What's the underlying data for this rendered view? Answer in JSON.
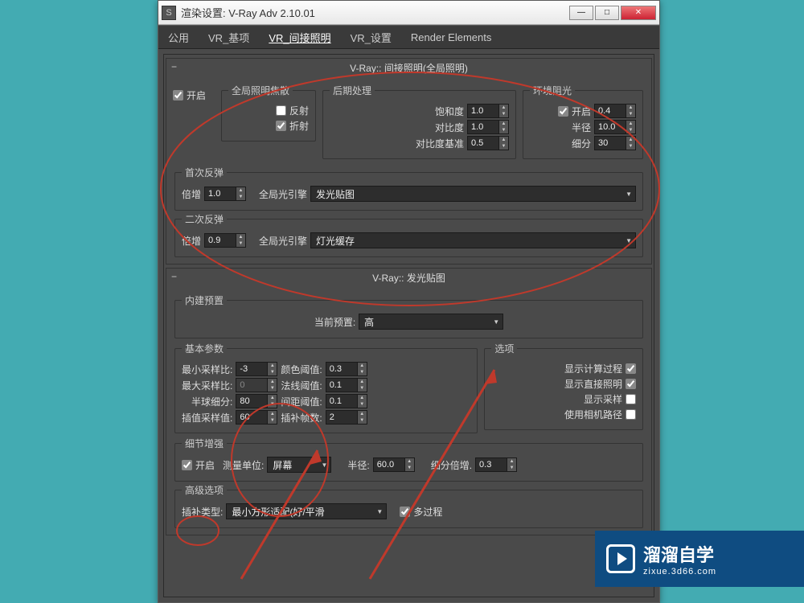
{
  "window": {
    "title": "渲染设置: V-Ray Adv 2.10.01",
    "min": "—",
    "max": "□",
    "close": "✕"
  },
  "tabs": {
    "common": "公用",
    "vrbase": "VR_基项",
    "vrindirect": "VR_间接照明",
    "vrsettings": "VR_设置",
    "renderelem": "Render Elements"
  },
  "rollout1": {
    "title": "V-Ray:: 间接照明(全局照明)",
    "enable": "开启",
    "caustics": {
      "legend": "全局照明焦散",
      "reflect": "反射",
      "refract": "折射"
    },
    "post": {
      "legend": "后期处理",
      "sat_label": "饱和度",
      "sat_val": "1.0",
      "contrast_label": "对比度",
      "contrast_val": "1.0",
      "base_label": "对比度基准",
      "base_val": "0.5"
    },
    "ao": {
      "legend": "环境阻光",
      "on": "开启",
      "on_val": "0.4",
      "radius_label": "半径",
      "radius_val": "10.0",
      "subdiv_label": "细分",
      "subdiv_val": "30"
    },
    "primary": {
      "legend": "首次反弹",
      "mult_label": "倍增",
      "mult_val": "1.0",
      "engine_label": "全局光引擎",
      "engine_val": "发光贴图"
    },
    "secondary": {
      "legend": "二次反弹",
      "mult_label": "倍增",
      "mult_val": "0.9",
      "engine_label": "全局光引擎",
      "engine_val": "灯光缓存"
    }
  },
  "rollout2": {
    "title": "V-Ray:: 发光贴图",
    "preset_group": "内建预置",
    "preset_label": "当前预置:",
    "preset_val": "高",
    "basic": {
      "legend": "基本参数",
      "minrate_label": "最小采样比:",
      "minrate_val": "-3",
      "maxrate_label": "最大采样比:",
      "maxrate_val": "0",
      "hsph_label": "半球细分:",
      "hsph_val": "80",
      "interp_label": "插值采样值:",
      "interp_val": "60",
      "clr_label": "颜色阈值:",
      "clr_val": "0.3",
      "nrm_label": "法线阈值:",
      "nrm_val": "0.1",
      "dist_label": "间距阈值:",
      "dist_val": "0.1",
      "frames_label": "插补帧数:",
      "frames_val": "2"
    },
    "options": {
      "legend": "选项",
      "show_calc": "显示计算过程",
      "show_direct": "显示直接照明",
      "show_samples": "显示采样",
      "use_camera": "使用相机路径"
    },
    "detail": {
      "legend": "细节增强",
      "on": "开启",
      "unit_label": "测量单位:",
      "unit_val": "屏幕",
      "radius_label": "半径:",
      "radius_val": "60.0",
      "subdiv_label": "细分倍增.",
      "subdiv_val": "0.3"
    },
    "advanced": {
      "legend": "高级选项",
      "type_label": "插补类型:",
      "type_val": "最小方形适配(好/平滑",
      "multipass": "多过程"
    }
  },
  "watermark": {
    "main": "溜溜自学",
    "sub": "zixue.3d66.com"
  }
}
